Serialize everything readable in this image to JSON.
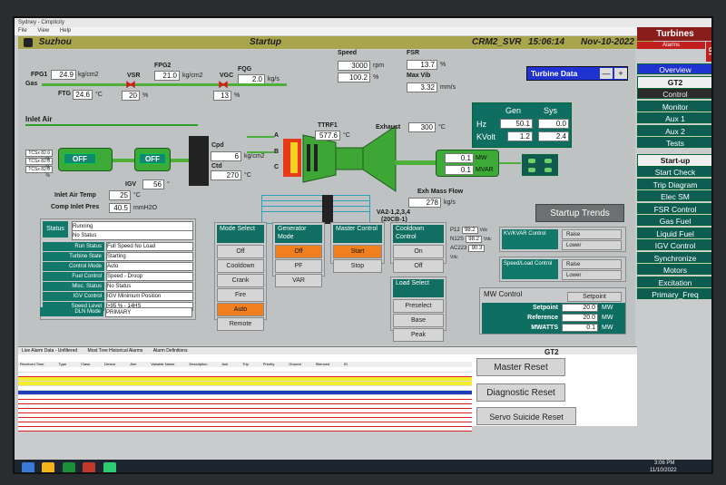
{
  "window": {
    "title": "Sydney - Cimplicity",
    "menu": [
      "File",
      "View",
      "Help"
    ]
  },
  "header": {
    "site": "Suzhou",
    "screen": "Startup",
    "unit_id": "CRM2_SVR",
    "time": "15:06:14",
    "date": "Nov-10-2022"
  },
  "fuel": {
    "fpg1_label": "FPG1",
    "fpg1": "24.9",
    "fpg1_unit": "kg/cm2",
    "fpg2_label": "FPG2",
    "fpg2": "21.0",
    "fpg2_unit": "kg/cm2",
    "fqg_label": "FQG",
    "fqg": "2.0",
    "fqg_unit": "kg/s",
    "ftg_label": "FTG",
    "ftg": "24.6",
    "ftg_unit": "°C",
    "vsr_label": "VSR",
    "vsr": "20",
    "vsr_unit": "%",
    "vgc_label": "VGC",
    "vgc": "13",
    "vgc_unit": "%",
    "gas_label": "Gas"
  },
  "speed": {
    "label": "Speed",
    "rpm": "3000",
    "rpm_unit": "rpm",
    "pct": "100.2",
    "pct_unit": "%"
  },
  "fsr": {
    "label": "FSR",
    "value": "13.7",
    "unit": "%"
  },
  "vib": {
    "label": "Max Vib",
    "value": "3.32",
    "unit": "mm/s"
  },
  "turbine_data": {
    "label": "Turbine Data",
    "minus": "—",
    "plus": "+"
  },
  "air": {
    "inlet_label": "Inlet Air",
    "igv_label": "IGV",
    "igv": "56",
    "igv_unit": "°",
    "off1": "OFF",
    "off2": "OFF",
    "cpd_label": "Cpd",
    "cpd": "6",
    "cpd_unit": "kg/cm2",
    "ctd_label": "Ctd",
    "ctd": "270",
    "ctd_unit": "°C",
    "tcs": [
      "TCSx 82.6 %",
      "TCSx 82.6 %",
      "TCSx 82.6 %"
    ],
    "inlet_temp_label": "Inlet Air Temp",
    "inlet_temp": "25",
    "inlet_temp_unit": "°C",
    "comp_pres_label": "Comp Inlet Pres",
    "comp_pres": "40.5",
    "comp_pres_unit": "mmH2O"
  },
  "combustor": {
    "ttrf1_label": "TTRF1",
    "ttrf1": "577.6",
    "ttrf1_unit": "°C",
    "ports": [
      "A",
      "B",
      "C"
    ],
    "va_label": "VA2-1,2,3,4",
    "va_sub": "(20CB-1)"
  },
  "exhaust": {
    "label": "Exhaust",
    "value": "300",
    "unit": "°C",
    "flow_label": "Exh Mass Flow",
    "flow": "278",
    "flow_unit": "kg/s"
  },
  "generator": {
    "gen_label": "Gen",
    "sys_label": "Sys",
    "hz_label": "Hz",
    "gen_hz": "50.1",
    "sys_hz": "0.0",
    "kv_label": "KVolt",
    "gen_kv": "1.2",
    "sys_kv": "2.4",
    "mw": "0.1",
    "mw_unit": "MW",
    "mvar": "0.1",
    "mvar_unit": "MVAR"
  },
  "startup_trends": "Startup Trends",
  "status": {
    "title": "Status",
    "status": "Running",
    "no_status": "No Status",
    "rows": [
      {
        "k": "Run Status",
        "v": "Full Speed No Load"
      },
      {
        "k": "Turbine State",
        "v": "Starting"
      },
      {
        "k": "Control Mode",
        "v": "Auto"
      },
      {
        "k": "Fuel Control",
        "v": "Speed - Droop"
      },
      {
        "k": "Misc. Status",
        "v": "No Status"
      },
      {
        "k": "IGV Control",
        "v": "IGV Minimum Position"
      },
      {
        "k": "Speed Level",
        "v": ">95 % - 14HS"
      }
    ],
    "dln_label": "DLN Mode",
    "dln": "PRIMARY"
  },
  "mode_select": {
    "title": "Mode Select",
    "items": [
      "Off",
      "Cooldown",
      "Crank",
      "Fire",
      "Auto",
      "Remote"
    ],
    "active": 4
  },
  "gen_mode": {
    "title": "Generator Mode",
    "items": [
      "Off",
      "PF",
      "VAR"
    ],
    "active": 0
  },
  "master_control": {
    "title": "Master Control",
    "items": [
      "Start",
      "Stop"
    ],
    "active": 0
  },
  "cooldown": {
    "title": "Cooldown Control",
    "items": [
      "On",
      "Off"
    ]
  },
  "load_select": {
    "title": "Load Select",
    "items": [
      "Preselect",
      "Base",
      "Peak"
    ]
  },
  "phase": {
    "p12_label": "P12",
    "p12": "98.2",
    "n23_label": "N12S",
    "n23": "98.2",
    "ac_label": "AC223",
    "ac": "90.3",
    "unit": "Vdc"
  },
  "kv_control": {
    "title": "KV/KVAR Control",
    "raise": "Raise",
    "lower": "Lower"
  },
  "speed_load": {
    "title": "Speed/Load Control",
    "raise": "Raise",
    "lower": "Lower"
  },
  "mw_control": {
    "title": "MW Control",
    "setpoint_btn": "Setpoint",
    "rows": [
      {
        "k": "Setpoint",
        "v": "20.0",
        "u": "MW"
      },
      {
        "k": "Reference",
        "v": "20.0",
        "u": "MW"
      },
      {
        "k": "MWATTS",
        "v": "0.1",
        "u": "MW"
      }
    ]
  },
  "sidebar": {
    "title": "Turbines",
    "alarms": "Alarms",
    "gt": "GT",
    "items": [
      {
        "label": "Overview",
        "style": "b"
      },
      {
        "label": "GT2",
        "style": "w"
      },
      {
        "label": "Control",
        "style": "g"
      },
      {
        "label": "Monitor",
        "style": "t"
      },
      {
        "label": "Aux 1",
        "style": "t"
      },
      {
        "label": "Aux 2",
        "style": "t"
      },
      {
        "label": "Tests",
        "style": "t"
      },
      {
        "label": "Start-up",
        "style": "w"
      },
      {
        "label": "Start Check",
        "style": "t"
      },
      {
        "label": "Trip Diagram",
        "style": "t"
      },
      {
        "label": "Elec SM",
        "style": "t"
      },
      {
        "label": "FSR Control",
        "style": "t"
      },
      {
        "label": "Gas Fuel",
        "style": "t"
      },
      {
        "label": "Liquid Fuel",
        "style": "t"
      },
      {
        "label": "IGV Control",
        "style": "t"
      },
      {
        "label": "Synchronize",
        "style": "t"
      },
      {
        "label": "Motors",
        "style": "t"
      },
      {
        "label": "Excitation",
        "style": "t"
      },
      {
        "label": "Primary_Freq",
        "style": "t"
      }
    ]
  },
  "alarm_window": {
    "tabs": [
      "Live Alarm Data - Unfiltered",
      "Most Tree Historical Alarms",
      "Alarm Definitions"
    ],
    "gt2": "GT2",
    "master_reset": "Master Reset",
    "diag_reset": "Diagnostic Reset",
    "servo_reset": "Servo Suicide Reset",
    "columns": [
      "Received Time",
      "Type",
      "Class",
      "Device",
      "Alm",
      "Variable Name",
      "Description",
      "Ack",
      "Trip",
      "Priority",
      "Ground",
      "Silenced",
      "ID"
    ]
  },
  "taskbar": {
    "time": "3:06 PM",
    "date": "11/10/2022"
  },
  "colors": {
    "accent": "#11786a",
    "header": "#a9a54c",
    "alarm_yellow": "#f2ee2a",
    "alarm_red": "#d81e1e",
    "active": "#f0801e"
  }
}
